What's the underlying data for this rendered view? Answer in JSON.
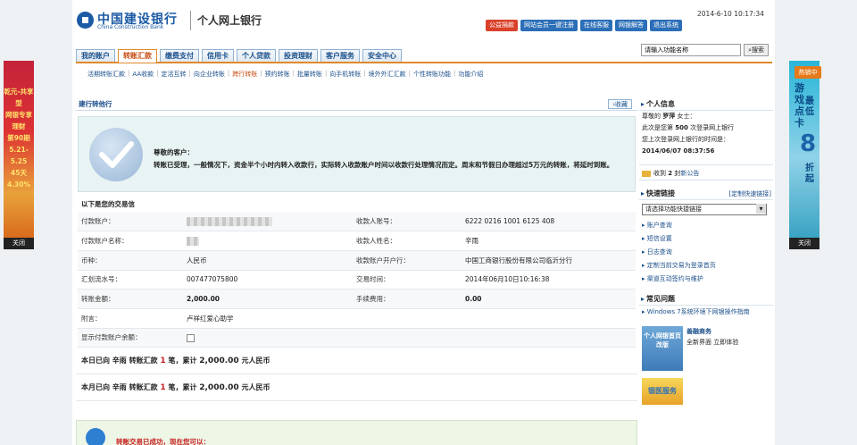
{
  "header": {
    "bank_name_cn": "中国建设银行",
    "bank_name_en": "China Construction Bank",
    "product": "个人网上银行",
    "datetime": "2014-6-10 10:17:34",
    "buttons": [
      "公益捐款",
      "网站会员一键注册",
      "在线客服",
      "网银解答",
      "退出系统"
    ]
  },
  "tabs": [
    "我的账户",
    "转账汇款",
    "缴费支付",
    "信用卡",
    "个人贷款",
    "投资理财",
    "客户服务",
    "安全中心"
  ],
  "active_tab": "转账汇款",
  "search": {
    "placeholder": "请输入功能名称",
    "button": "搜索"
  },
  "submenu": [
    "活期转账汇款",
    "AA收款",
    "定活互转",
    "向企业转账",
    "跨行转账",
    "预约转账",
    "批量转账",
    "向手机转账",
    "境外外汇汇款",
    "个性转账功能",
    "功能介绍"
  ],
  "section_title": "建行转他行",
  "collect": "收藏",
  "success": {
    "greeting": "尊敬的客户：",
    "message": "转账已受理，一般情况下，资金半个小时内转入收款行，实际转入收款账户时间以收款行处理情况而定。周末和节假日办理超过5万元的转账，将延时到账。"
  },
  "detail_title": "以下是您的交易信",
  "details": {
    "payer_account_label": "付款账户：",
    "payee_account_label": "收款人账号：",
    "payee_account": "6222 0216 1001 6125 408",
    "payer_name_label": "付款账户名称：",
    "payee_name_label": "收款人姓名：",
    "payee_name": "辛雨",
    "currency_label": "币种：",
    "currency": "人民币",
    "payee_bank_label": "收款账户开户行：",
    "payee_bank": "中国工商银行股份有限公司临沂分行",
    "serial_label": "汇划流水号：",
    "serial": "007477075800",
    "time_label": "交易时间：",
    "time": "2014年06月10日10:16:38",
    "amount_label": "转账金额：",
    "amount": "2,000.00",
    "fee_label": "手续费用：",
    "fee": "0.00",
    "note_label": "附言：",
    "note": "卢祥红爱心助学",
    "show_balance_label": "显示付款账户余额："
  },
  "summary_today": {
    "prefix": "本日已向",
    "name": "辛雨",
    "type": "转账汇款",
    "count": "1",
    "unit1": "笔，累计",
    "amount": "2,000.00",
    "unit2": "元人民币"
  },
  "summary_month": {
    "prefix": "本月已向",
    "name": "辛雨",
    "type": "转账汇款",
    "count": "1",
    "unit1": "笔，累计",
    "amount": "2,000.00",
    "unit2": "元人民币"
  },
  "bottom_text": "转账交易已成功，现在您可以：",
  "right": {
    "info_title": "个人信息",
    "greeting": "尊敬的",
    "user_name": "罗萍",
    "honorific": "女士：",
    "login_count_prefix": "此次是您第",
    "login_count": "500",
    "login_count_suffix": "次登录网上银行",
    "last_login_label": "您上次登录网上银行的时间是：",
    "last_login": "2014/06/07 08:37:56",
    "mail_prefix": "收到",
    "mail_count": "2",
    "mail_suffix": "封",
    "mail_link": "新公告",
    "quick_title": "快速链接",
    "quick_custom": "[定制快速链接]",
    "quick_select": "请选择功能快捷链接",
    "quick_items": [
      "账户查询",
      "短信设置",
      "日志查询",
      "定制当前交易为登录首页",
      "渠道互动签约与维护"
    ],
    "faq_title": "常见问题",
    "faq_items": [
      "Windows 7系统环境下网银操作指南"
    ],
    "promo_img_text": "个人网银首页改版",
    "promo_title": "善融商务",
    "promo_line": "全新界面 立即体验",
    "promo2_text": "银医服务"
  },
  "ads": {
    "left_lines": [
      "乾元-共享型",
      "网银专享理财",
      "第90期",
      "5.21-5.25",
      "45天 4.30%"
    ],
    "left_close": "关闭",
    "right_badge": "热销中",
    "right_text1": "游戏点卡",
    "right_text2": "最低",
    "right_big": "8",
    "right_text3": "折起",
    "right_close": "关闭"
  }
}
